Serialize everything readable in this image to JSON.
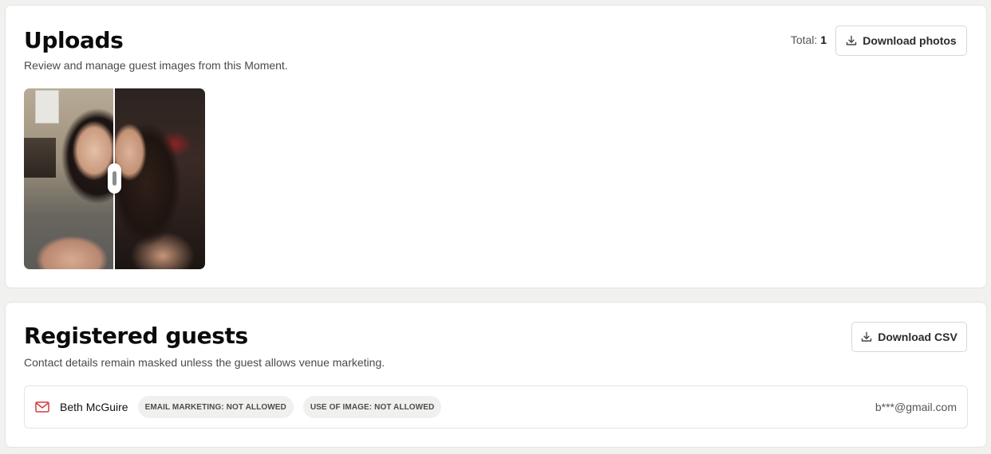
{
  "uploads": {
    "title": "Uploads",
    "subtitle": "Review and manage guest images from this Moment.",
    "total_label": "Total:",
    "total_value": "1",
    "download_button_label": "Download photos",
    "download_icon": "download-icon",
    "images": [
      {
        "kind": "before-after-comparison",
        "slider_position": 0.5
      }
    ]
  },
  "guests": {
    "title": "Registered guests",
    "subtitle": "Contact details remain masked unless the guest allows venue marketing.",
    "download_button_label": "Download CSV",
    "download_icon": "download-icon",
    "rows": [
      {
        "icon": "mail-icon",
        "icon_color": "#d63a3a",
        "name": "Beth McGuire",
        "chips": [
          "EMAIL MARKETING: NOT ALLOWED",
          "USE OF IMAGE: NOT ALLOWED"
        ],
        "email": "b***@gmail.com"
      }
    ]
  }
}
